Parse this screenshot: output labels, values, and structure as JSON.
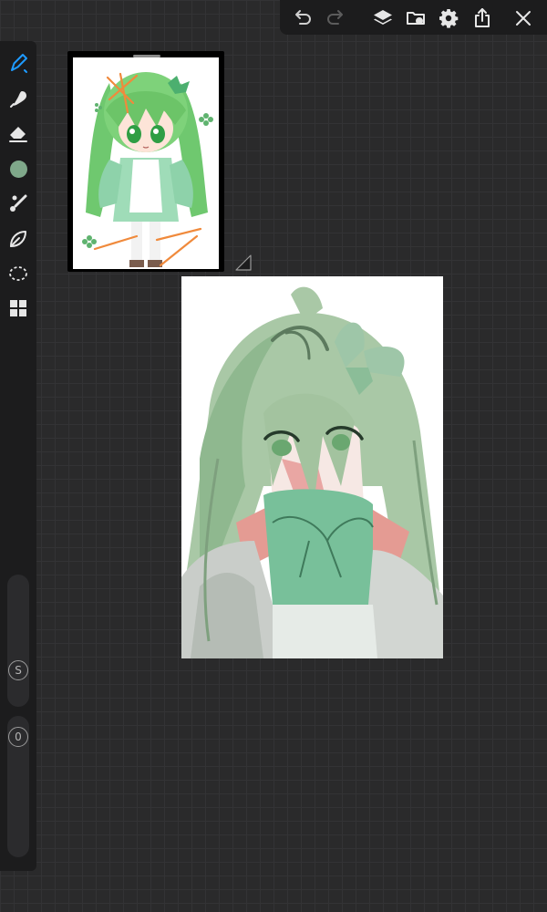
{
  "toolbar": {
    "icons": [
      "undo-icon",
      "redo-icon",
      "layers-icon",
      "gallery-icon",
      "settings-icon",
      "share-icon",
      "close-icon"
    ]
  },
  "sidebar": {
    "tools": [
      "brush-icon",
      "smudge-icon",
      "eraser-icon",
      "color-swatch",
      "brush-studio-icon",
      "liquify-icon",
      "selection-icon",
      "quick-menu-icon"
    ],
    "active_tool": "brush-icon",
    "current_color": "#7fa88a",
    "size_label": "S",
    "opacity_label": "0"
  },
  "colors": {
    "accent": "#1e9bff",
    "hair": "#8fb88f",
    "hair_dark": "#6f9b76",
    "skin": "#e8a2a0",
    "dress": "#b8c1b8",
    "bow": "#72b394"
  }
}
